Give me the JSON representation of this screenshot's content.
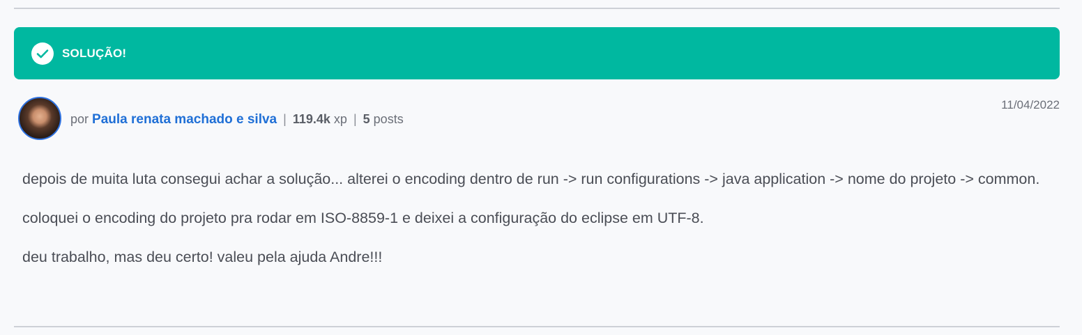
{
  "banner": {
    "label": "SOLUÇÃO!",
    "icon": "check-circle-icon",
    "color": "#00b8a0"
  },
  "author": {
    "prefix": "por",
    "name": "Paula renata machado e silva",
    "xp_value": "119.4k",
    "xp_unit": "xp",
    "posts_value": "5",
    "posts_unit": "posts",
    "separator": "|",
    "link_color": "#1f6fd6"
  },
  "post": {
    "date": "11/04/2022",
    "paragraphs": [
      "depois de muita luta consegui achar a solução... alterei o encoding dentro de run -> run configurations -> java application -> nome do projeto -> common.",
      "coloquei o encoding do projeto pra rodar em ISO-8859-1 e deixei a configuração do eclipse em UTF-8.",
      "deu trabalho, mas deu certo! valeu pela ajuda Andre!!!"
    ]
  }
}
